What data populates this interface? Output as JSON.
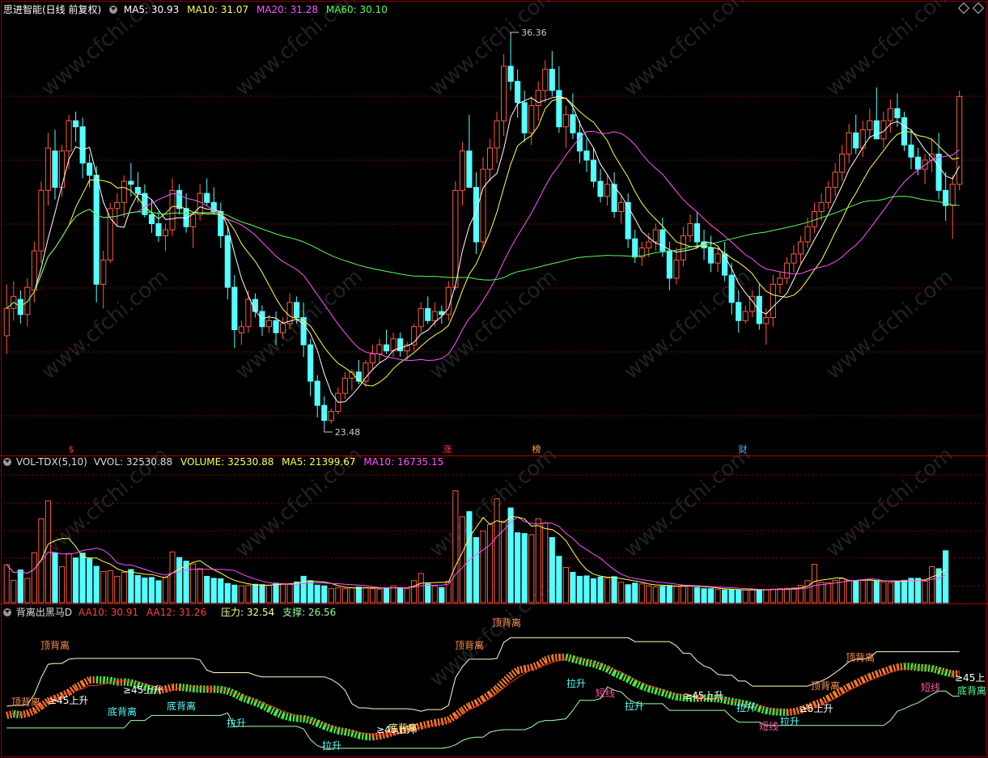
{
  "main": {
    "title": "思进智能(日线 前复权)",
    "ma5": "MA5: 30.93",
    "ma10": "MA10: 31.07",
    "ma20": "MA20: 31.28",
    "ma60": "MA60: 30.10",
    "high_label": "36.36",
    "low_label": "23.48",
    "markers": [
      "$",
      "涨",
      "榜",
      "财"
    ]
  },
  "volume": {
    "title": "VOL-TDX(5,10)",
    "vvol": "VVOL: 32530.88",
    "volume": "VOLUME: 32530.88",
    "ma5": "MA5: 21399.67",
    "ma10": "MA10: 16735.15"
  },
  "indicator": {
    "title": "背离出黑马D",
    "aa10": "AA10: 30.91",
    "aa12": "AA12: 31.26",
    "pressure": "压力: 32.54",
    "support": "支撑: 26.56",
    "top_cut": "顶背离",
    "labels": [
      "顶背离",
      "顶背离",
      "≥45上升",
      "≥45上升",
      "底背离",
      "底背离",
      "拉升",
      "拉升",
      "≥45上升",
      "底背离",
      "顶背离",
      "拉升",
      "短线",
      "拉升",
      "≥45上升",
      "拉升",
      "短线",
      "拉升",
      "≥5上升",
      "顶背离",
      "顶背离",
      "短线",
      "底背离",
      "≥45上"
    ]
  },
  "colors": {
    "bg": "#000000",
    "up": "#ff5a3c",
    "down": "#54ffff",
    "ma5": "#ffffff",
    "ma10": "#ffff55",
    "ma20": "#ff55ff",
    "ma60": "#55ff55",
    "grid": "#8a0000"
  },
  "watermark": "www.cfchi.com",
  "chart_data": [
    {
      "type": "candlestick",
      "title": "思进智能(日线 前复权)",
      "ylim": [
        23.0,
        37.0
      ],
      "annotations": {
        "high": 36.36,
        "low": 23.48
      },
      "ohlc": [
        [
          26.5,
          28.2,
          25.9,
          27.4
        ],
        [
          27.4,
          28.3,
          27.0,
          27.8
        ],
        [
          27.7,
          28.0,
          26.9,
          27.2
        ],
        [
          27.2,
          28.4,
          26.8,
          28.1
        ],
        [
          28.0,
          29.6,
          27.6,
          29.3
        ],
        [
          29.3,
          31.6,
          28.9,
          31.3
        ],
        [
          31.3,
          33.2,
          30.8,
          32.7
        ],
        [
          32.6,
          33.3,
          31.0,
          31.4
        ],
        [
          31.4,
          32.8,
          31.1,
          32.6
        ],
        [
          32.6,
          33.8,
          32.0,
          33.6
        ],
        [
          33.6,
          33.9,
          32.9,
          33.4
        ],
        [
          33.4,
          33.7,
          31.7,
          32.2
        ],
        [
          32.2,
          32.5,
          31.4,
          31.8
        ],
        [
          31.8,
          32.1,
          27.6,
          28.2
        ],
        [
          28.2,
          29.3,
          27.4,
          29.0
        ],
        [
          29.0,
          30.9,
          28.9,
          30.7
        ],
        [
          30.7,
          31.2,
          30.1,
          30.9
        ],
        [
          30.9,
          31.8,
          30.4,
          31.6
        ],
        [
          31.6,
          32.2,
          31.1,
          31.5
        ],
        [
          31.4,
          31.9,
          30.9,
          31.2
        ],
        [
          31.2,
          31.5,
          30.4,
          30.5
        ],
        [
          30.5,
          31.0,
          29.9,
          30.2
        ],
        [
          30.2,
          30.6,
          29.6,
          29.8
        ],
        [
          29.8,
          30.2,
          29.3,
          30.0
        ],
        [
          30.0,
          31.7,
          29.8,
          31.3
        ],
        [
          31.3,
          31.5,
          30.5,
          30.7
        ],
        [
          30.7,
          31.2,
          29.9,
          30.1
        ],
        [
          30.1,
          30.6,
          29.4,
          30.5
        ],
        [
          30.5,
          31.5,
          30.3,
          31.2
        ],
        [
          31.2,
          31.7,
          30.8,
          30.9
        ],
        [
          30.9,
          31.4,
          30.5,
          30.6
        ],
        [
          30.6,
          30.9,
          29.4,
          29.8
        ],
        [
          29.8,
          30.1,
          27.7,
          28.1
        ],
        [
          28.1,
          28.5,
          26.1,
          26.7
        ],
        [
          26.6,
          27.0,
          26.2,
          26.8
        ],
        [
          26.8,
          28.0,
          26.6,
          27.7
        ],
        [
          27.7,
          27.9,
          27.1,
          27.3
        ],
        [
          27.3,
          27.5,
          26.5,
          26.8
        ],
        [
          26.8,
          27.2,
          26.6,
          27.0
        ],
        [
          27.0,
          27.3,
          26.2,
          26.6
        ],
        [
          26.6,
          27.1,
          26.4,
          26.9
        ],
        [
          26.9,
          27.9,
          26.7,
          27.6
        ],
        [
          27.6,
          27.8,
          26.9,
          27.1
        ],
        [
          27.1,
          27.6,
          25.8,
          26.2
        ],
        [
          26.2,
          26.4,
          24.5,
          25.0
        ],
        [
          25.0,
          25.2,
          23.8,
          24.2
        ],
        [
          24.2,
          24.5,
          23.48,
          23.7
        ],
        [
          23.7,
          24.1,
          23.6,
          24.0
        ],
        [
          24.0,
          24.8,
          23.9,
          24.6
        ],
        [
          24.6,
          25.3,
          24.4,
          25.1
        ],
        [
          25.1,
          25.4,
          24.7,
          25.3
        ],
        [
          25.3,
          25.7,
          24.9,
          25.0
        ],
        [
          25.0,
          25.7,
          24.8,
          25.6
        ],
        [
          25.6,
          26.2,
          25.4,
          25.9
        ],
        [
          25.9,
          26.4,
          25.6,
          26.2
        ],
        [
          26.2,
          26.7,
          25.9,
          26.0
        ],
        [
          26.0,
          26.6,
          25.8,
          26.4
        ],
        [
          26.4,
          26.6,
          25.8,
          26.0
        ],
        [
          26.0,
          26.3,
          25.7,
          26.2
        ],
        [
          26.2,
          26.9,
          26.0,
          26.8
        ],
        [
          26.8,
          27.6,
          26.6,
          27.4
        ],
        [
          27.4,
          27.8,
          26.9,
          27.0
        ],
        [
          27.0,
          27.6,
          26.8,
          27.3
        ],
        [
          27.3,
          27.5,
          26.9,
          27.2
        ],
        [
          27.2,
          28.3,
          27.0,
          28.1
        ],
        [
          28.1,
          31.6,
          28.0,
          31.3
        ],
        [
          31.3,
          32.9,
          30.8,
          32.6
        ],
        [
          32.6,
          33.8,
          32.2,
          31.4
        ],
        [
          31.4,
          31.9,
          29.2,
          29.6
        ],
        [
          29.6,
          32.4,
          29.4,
          32.0
        ],
        [
          32.0,
          33.0,
          31.6,
          32.7
        ],
        [
          32.7,
          33.9,
          32.2,
          33.6
        ],
        [
          33.6,
          35.8,
          33.1,
          35.4
        ],
        [
          35.4,
          36.36,
          34.6,
          34.9
        ],
        [
          34.9,
          35.3,
          33.7,
          34.2
        ],
        [
          34.2,
          34.6,
          32.9,
          33.2
        ],
        [
          33.2,
          34.4,
          32.8,
          34.1
        ],
        [
          34.1,
          34.9,
          33.6,
          34.6
        ],
        [
          34.6,
          35.6,
          34.2,
          35.3
        ],
        [
          35.3,
          35.9,
          34.4,
          34.6
        ],
        [
          34.6,
          35.4,
          33.2,
          33.4
        ],
        [
          33.4,
          34.1,
          32.7,
          33.8
        ],
        [
          33.8,
          34.5,
          33.0,
          33.2
        ],
        [
          33.2,
          33.6,
          32.2,
          32.6
        ],
        [
          32.6,
          33.0,
          31.9,
          32.3
        ],
        [
          32.3,
          32.7,
          31.4,
          31.6
        ],
        [
          31.6,
          32.0,
          30.9,
          31.1
        ],
        [
          31.1,
          31.8,
          30.8,
          31.5
        ],
        [
          31.5,
          31.9,
          30.4,
          30.6
        ],
        [
          30.6,
          31.1,
          30.2,
          30.9
        ],
        [
          30.9,
          31.2,
          29.4,
          29.7
        ],
        [
          29.7,
          30.0,
          28.9,
          29.1
        ],
        [
          29.1,
          29.6,
          28.8,
          29.4
        ],
        [
          29.4,
          29.9,
          29.1,
          29.6
        ],
        [
          29.6,
          30.2,
          29.3,
          30.0
        ],
        [
          30.0,
          30.4,
          29.1,
          29.3
        ],
        [
          29.3,
          29.6,
          28.0,
          28.4
        ],
        [
          28.4,
          29.4,
          28.2,
          29.0
        ],
        [
          29.0,
          30.1,
          28.8,
          29.8
        ],
        [
          29.8,
          30.5,
          29.6,
          30.2
        ],
        [
          30.2,
          30.6,
          29.4,
          29.6
        ],
        [
          29.6,
          30.0,
          29.0,
          29.4
        ],
        [
          29.4,
          29.8,
          28.6,
          28.9
        ],
        [
          28.9,
          29.4,
          28.6,
          29.2
        ],
        [
          29.2,
          29.6,
          28.3,
          28.5
        ],
        [
          28.5,
          28.9,
          27.2,
          27.6
        ],
        [
          27.6,
          28.0,
          26.6,
          27.0
        ],
        [
          27.0,
          27.5,
          26.9,
          27.3
        ],
        [
          27.3,
          28.0,
          27.1,
          27.8
        ],
        [
          27.8,
          28.2,
          26.7,
          26.9
        ],
        [
          26.9,
          27.4,
          26.2,
          27.1
        ],
        [
          27.1,
          28.5,
          26.8,
          28.2
        ],
        [
          28.2,
          28.6,
          27.9,
          28.4
        ],
        [
          28.4,
          29.1,
          28.2,
          28.9
        ],
        [
          28.9,
          29.5,
          28.6,
          29.2
        ],
        [
          29.2,
          29.8,
          28.9,
          29.6
        ],
        [
          29.6,
          30.4,
          29.4,
          30.1
        ],
        [
          30.1,
          30.9,
          29.9,
          30.6
        ],
        [
          30.6,
          31.2,
          30.3,
          30.9
        ],
        [
          30.9,
          31.6,
          30.7,
          31.4
        ],
        [
          31.4,
          32.2,
          31.1,
          31.9
        ],
        [
          31.9,
          32.8,
          31.6,
          32.5
        ],
        [
          32.5,
          33.5,
          32.2,
          33.2
        ],
        [
          33.2,
          33.8,
          32.5,
          32.7
        ],
        [
          32.7,
          33.6,
          32.4,
          33.3
        ],
        [
          33.3,
          34.0,
          33.0,
          33.6
        ],
        [
          33.6,
          34.7,
          33.2,
          33.0
        ],
        [
          33.0,
          33.9,
          32.7,
          33.6
        ],
        [
          33.6,
          34.3,
          33.2,
          34.0
        ],
        [
          34.0,
          34.5,
          33.4,
          33.7
        ],
        [
          33.7,
          33.9,
          32.6,
          32.8
        ],
        [
          32.8,
          33.3,
          32.0,
          32.4
        ],
        [
          32.4,
          32.7,
          31.8,
          32.0
        ],
        [
          32.0,
          32.5,
          31.5,
          32.3
        ],
        [
          32.3,
          33.0,
          31.9,
          32.5
        ],
        [
          32.5,
          33.2,
          31.0,
          31.3
        ],
        [
          31.3,
          31.9,
          30.3,
          30.8
        ],
        [
          30.8,
          31.8,
          29.7,
          31.5
        ],
        [
          31.5,
          34.6,
          31.3,
          34.4
        ]
      ],
      "series": [
        {
          "name": "MA5",
          "value": 30.93
        },
        {
          "name": "MA10",
          "value": 31.07
        },
        {
          "name": "MA20",
          "value": 31.28
        },
        {
          "name": "MA60",
          "value": 30.1
        }
      ]
    },
    {
      "type": "bar",
      "title": "VOL-TDX(5,10)",
      "ylim": [
        0,
        33000
      ],
      "values": [
        9500,
        5600,
        8200,
        6100,
        12500,
        21000,
        25500,
        12400,
        9000,
        12300,
        11200,
        12400,
        11000,
        9100,
        7800,
        8000,
        6600,
        7600,
        8300,
        6800,
        6200,
        6300,
        5500,
        6400,
        12700,
        11300,
        10400,
        9700,
        8500,
        6600,
        6100,
        6000,
        4800,
        4400,
        4200,
        4300,
        4600,
        4500,
        4300,
        4900,
        4800,
        4800,
        5200,
        6600,
        5500,
        4400,
        4200,
        3500,
        3700,
        3500,
        3700,
        3900,
        3800,
        3500,
        3400,
        3700,
        4200,
        3800,
        3500,
        5500,
        7300,
        4700,
        4200,
        3800,
        5400,
        28000,
        21500,
        22800,
        16300,
        17900,
        19600,
        26000,
        20400,
        23700,
        17500,
        17300,
        17000,
        21000,
        19900,
        16300,
        11600,
        8800,
        7600,
        6600,
        6700,
        6000,
        6400,
        6200,
        6500,
        5100,
        4500,
        4900,
        4700,
        4200,
        4000,
        4100,
        4300,
        4100,
        4300,
        4200,
        3800,
        3500,
        3500,
        3300,
        3200,
        3300,
        3100,
        3200,
        3300,
        3200,
        3300,
        3400,
        3500,
        3600,
        3700,
        4300,
        5500,
        9600,
        5100,
        5000,
        5600,
        6000,
        5600,
        5500,
        5600,
        5600,
        5400,
        5200,
        5000,
        5300,
        5600,
        6100,
        6100,
        5400,
        9000,
        8500,
        13000
      ],
      "series": [
        {
          "name": "MA5",
          "value": 21399.67
        },
        {
          "name": "MA10",
          "value": 16735.15
        }
      ]
    },
    {
      "type": "line",
      "title": "背离出黑马D",
      "series": [
        {
          "name": "AA10",
          "value": 30.91
        },
        {
          "name": "AA12",
          "value": 31.26
        },
        {
          "name": "压力",
          "value": 32.54
        },
        {
          "name": "支撑",
          "value": 26.56
        }
      ]
    }
  ]
}
